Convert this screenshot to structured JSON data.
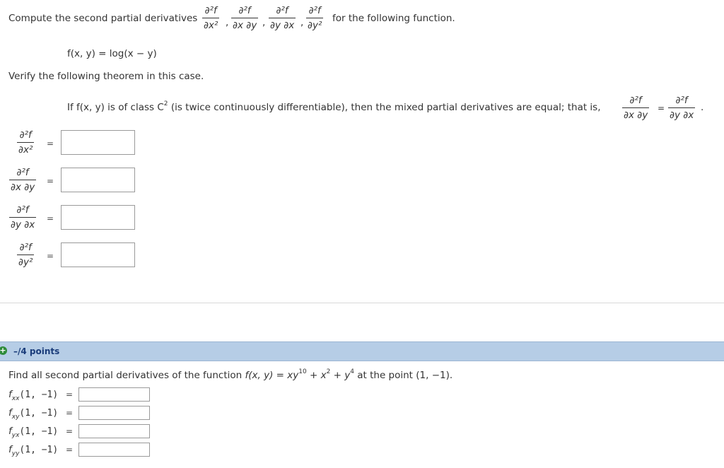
{
  "q1": {
    "intro_prefix": "Compute the second partial derivatives",
    "intro_suffix": "for the following function.",
    "deriv_num": "∂²f",
    "d_xx": "∂x²",
    "d_xy": "∂x ∂y",
    "d_yx": "∂y ∂x",
    "d_yy": "∂y²",
    "comma": ",",
    "function_text": "f(x, y) = log(x − y)",
    "verify_text": "Verify the following theorem in this case.",
    "theorem_prefix": "If f(x, y) is of class C",
    "theorem_sup": "2",
    "theorem_suffix": "(is twice continuously differentiable), then the mixed partial derivatives are equal; that is,",
    "equals": "=",
    "period": "."
  },
  "q2": {
    "points": "–/4 points",
    "prompt_prefix": "Find all second partial derivatives of the function",
    "func_lhs": "f(x, y) = xy",
    "exp10": "10",
    "plus_x": "+ x",
    "exp2": "2",
    "plus_y": "+ y",
    "exp4": "4",
    "prompt_suffix": "at the point (1, −1).",
    "rows": [
      {
        "sub": "xx",
        "arg": "(1, −1)"
      },
      {
        "sub": "xy",
        "arg": "(1, −1)"
      },
      {
        "sub": "yx",
        "arg": "(1, −1)"
      },
      {
        "sub": "yy",
        "arg": "(1, −1)"
      }
    ],
    "f_letter": "f",
    "equals": "="
  }
}
